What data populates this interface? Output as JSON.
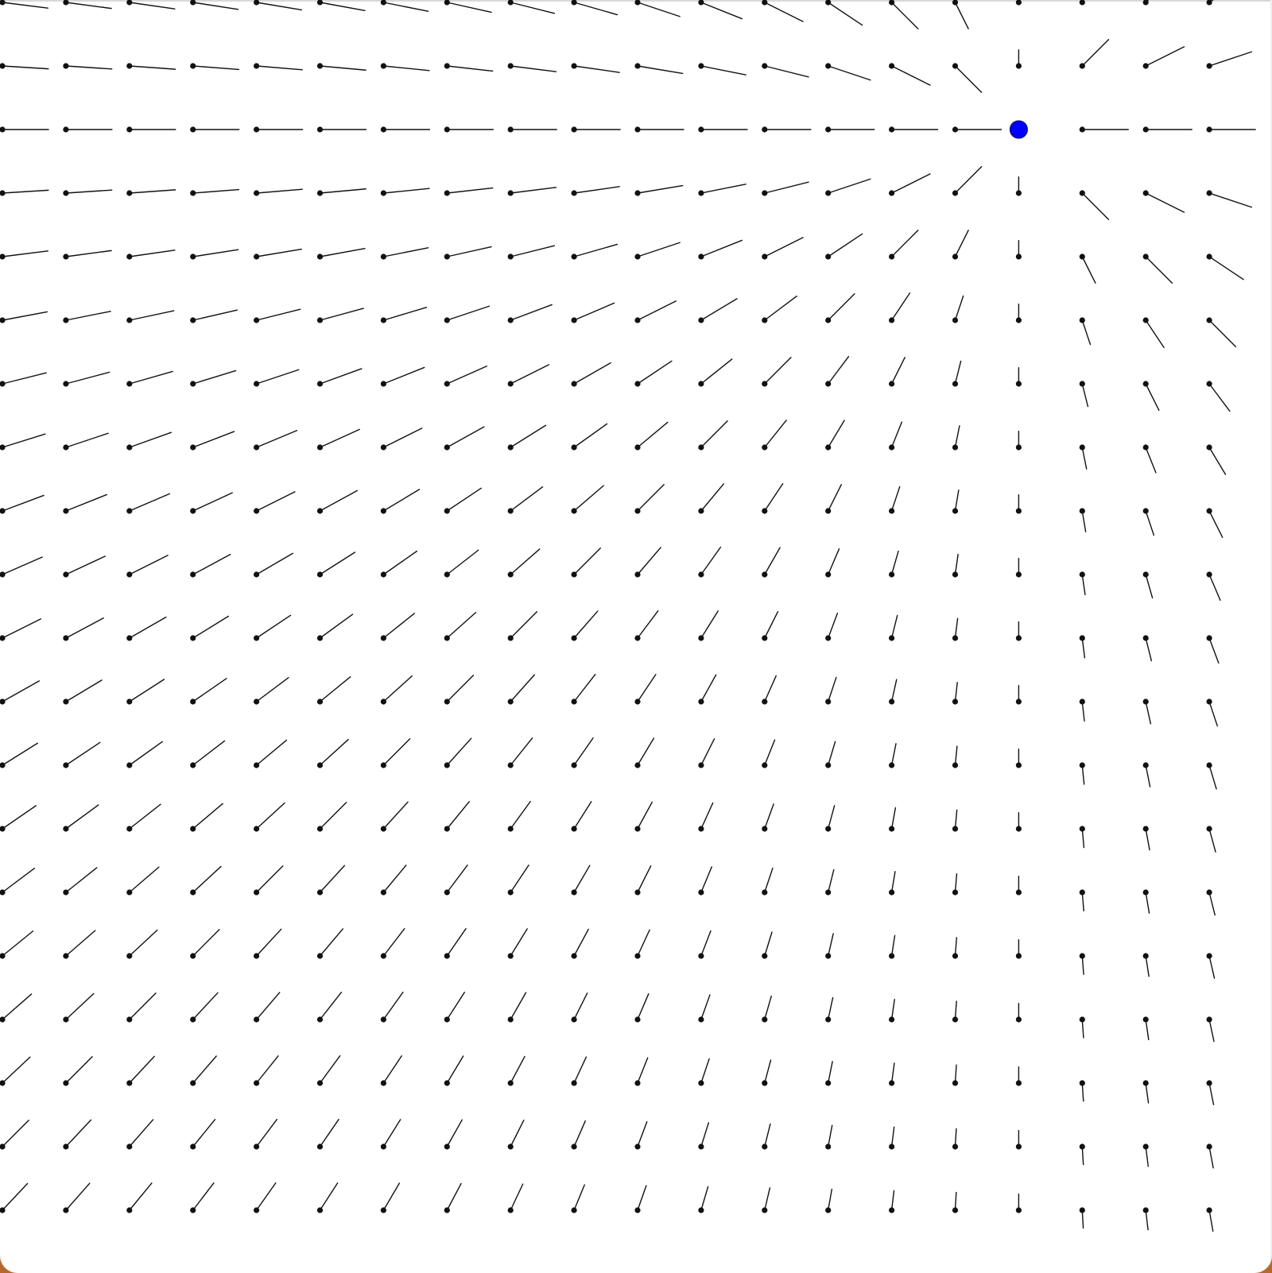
{
  "canvas": {
    "background": "#ffffff",
    "frame_color": "#b5692f"
  },
  "field": {
    "needle_color": "#111111",
    "columns": 20,
    "rows": 20
  },
  "source_point": {
    "color": "#0000ff",
    "grid_column": 16,
    "grid_row": 2
  }
}
